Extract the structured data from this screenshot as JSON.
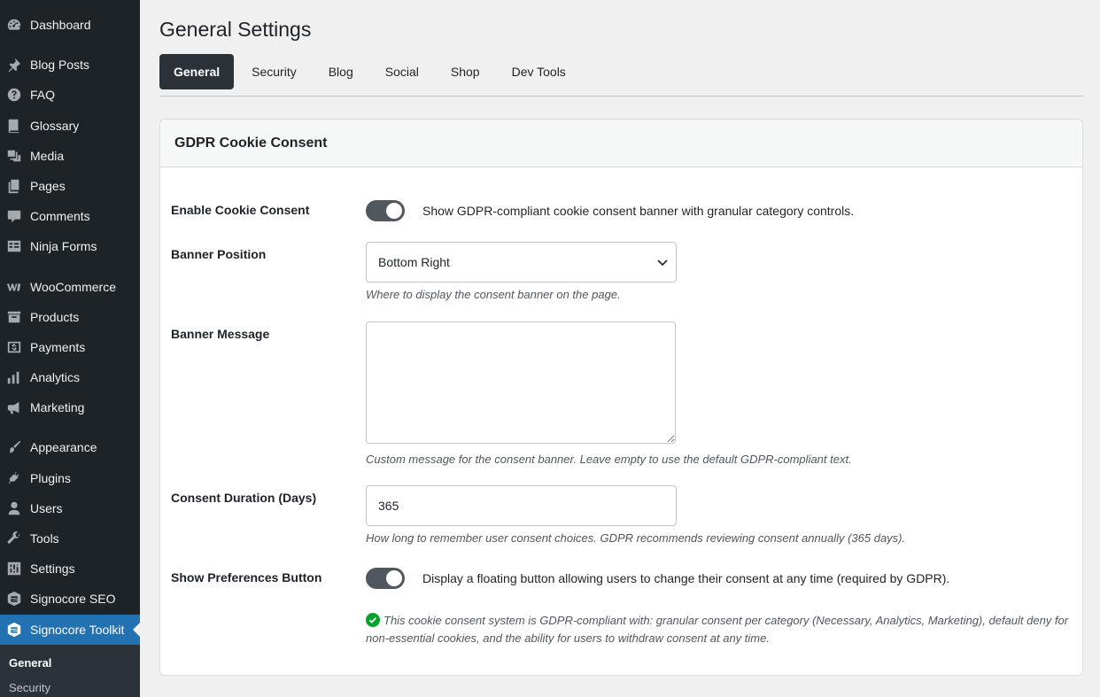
{
  "sidebar": {
    "items": [
      {
        "label": "Dashboard",
        "icon": "dashboard-icon"
      },
      {
        "label": "Blog Posts",
        "icon": "pin-icon"
      },
      {
        "label": "FAQ",
        "icon": "help-icon"
      },
      {
        "label": "Glossary",
        "icon": "book-icon"
      },
      {
        "label": "Media",
        "icon": "media-icon"
      },
      {
        "label": "Pages",
        "icon": "pages-icon"
      },
      {
        "label": "Comments",
        "icon": "comments-icon"
      },
      {
        "label": "Ninja Forms",
        "icon": "forms-icon"
      },
      {
        "label": "WooCommerce",
        "icon": "woocommerce-icon"
      },
      {
        "label": "Products",
        "icon": "archive-icon"
      },
      {
        "label": "Payments",
        "icon": "payments-icon"
      },
      {
        "label": "Analytics",
        "icon": "bar-chart-icon"
      },
      {
        "label": "Marketing",
        "icon": "megaphone-icon"
      },
      {
        "label": "Appearance",
        "icon": "brush-icon"
      },
      {
        "label": "Plugins",
        "icon": "plug-icon"
      },
      {
        "label": "Users",
        "icon": "user-icon"
      },
      {
        "label": "Tools",
        "icon": "wrench-icon"
      },
      {
        "label": "Settings",
        "icon": "settings-icon"
      },
      {
        "label": "Signocore SEO",
        "icon": "signocore-logo-icon"
      },
      {
        "label": "Signocore Toolkit",
        "icon": "signocore-gear-icon"
      }
    ],
    "submenu": [
      {
        "label": "General"
      },
      {
        "label": "Security"
      }
    ]
  },
  "page": {
    "title": "General Settings",
    "tabs": [
      {
        "label": "General"
      },
      {
        "label": "Security"
      },
      {
        "label": "Blog"
      },
      {
        "label": "Social"
      },
      {
        "label": "Shop"
      },
      {
        "label": "Dev Tools"
      }
    ]
  },
  "panel": {
    "title": "GDPR Cookie Consent",
    "enable_consent": {
      "label": "Enable Cookie Consent",
      "description": "Show GDPR-compliant cookie consent banner with granular category controls.",
      "enabled": true
    },
    "banner_position": {
      "label": "Banner Position",
      "value": "Bottom Right",
      "help": "Where to display the consent banner on the page."
    },
    "banner_message": {
      "label": "Banner Message",
      "value": "",
      "help": "Custom message for the consent banner. Leave empty to use the default GDPR-compliant text."
    },
    "consent_duration": {
      "label": "Consent Duration (Days)",
      "value": "365",
      "help": "How long to remember user consent choices. GDPR recommends reviewing consent annually (365 days)."
    },
    "preferences_button": {
      "label": "Show Preferences Button",
      "description": "Display a floating button allowing users to change their consent at any time (required by GDPR).",
      "enabled": true
    },
    "compliance_note": "This cookie consent system is GDPR-compliant with: granular consent per category (Necessary, Analytics, Marketing), default deny for non-essential cookies, and the ability for users to withdraw consent at any time."
  },
  "colors": {
    "sidebar_bg": "#1d2327",
    "active_menu": "#2271b1",
    "tab_active_bg": "#2c3338",
    "toggle_on": "#50575e",
    "success_green": "#00a32a"
  }
}
